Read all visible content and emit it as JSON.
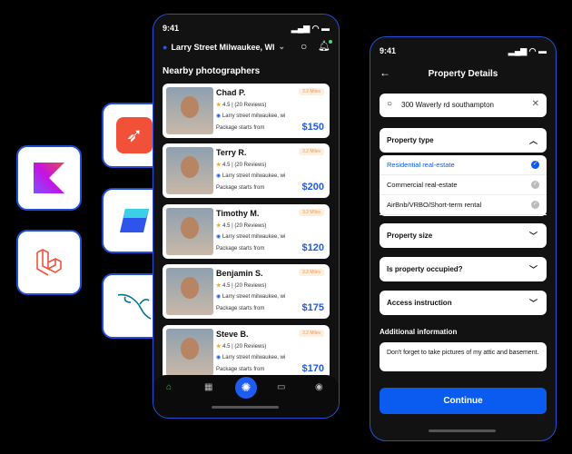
{
  "tech_icons": [
    "swift-icon",
    "kotlin-icon",
    "appwrite-icon",
    "laravel-icon",
    "mysql-icon"
  ],
  "left_phone": {
    "time": "9:41",
    "location": "Larry Street Milwaukee, WI",
    "section_title": "Nearby photographers",
    "photographers": [
      {
        "name": "Chad P.",
        "distance": "3.2 Miles",
        "rating": "4.5",
        "reviews": "(20 Reviews)",
        "address": "Larry street milwaukee, wi",
        "package_label": "Package starts from",
        "price": "$150"
      },
      {
        "name": "Terry R.",
        "distance": "3.2 Miles",
        "rating": "4.5",
        "reviews": "(20 Reviews)",
        "address": "Larry street milwaukee, wi",
        "package_label": "Package starts from",
        "price": "$200"
      },
      {
        "name": "Timothy M.",
        "distance": "3.2 Miles",
        "rating": "4.5",
        "reviews": "(20 Reviews)",
        "address": "Larry street milwaukee, wi",
        "package_label": "Package starts from",
        "price": "$120"
      },
      {
        "name": "Benjamin S.",
        "distance": "3.2 Miles",
        "rating": "4.5",
        "reviews": "(20 Reviews)",
        "address": "Larry street milwaukee, wi",
        "package_label": "Package starts from",
        "price": "$175"
      },
      {
        "name": "Steve B.",
        "distance": "3.2 Miles",
        "rating": "4.5",
        "reviews": "(20 Reviews)",
        "address": "Larry street milwaukee, wi",
        "package_label": "Package starts from",
        "price": "$170"
      }
    ]
  },
  "right_phone": {
    "time": "9:41",
    "title": "Property Details",
    "search_value": "300 Waverly rd southampton",
    "property_type_label": "Property type",
    "options": [
      {
        "label": "Residential real-estate",
        "selected": true
      },
      {
        "label": "Commercial real-estate",
        "selected": false
      },
      {
        "label": "AirBnb/VRBO/Short-term rental",
        "selected": false
      }
    ],
    "property_size_label": "Property size",
    "occupied_label": "Is property occupied?",
    "access_label": "Access instruction",
    "additional_label": "Additional information",
    "additional_value": "Don't forget to take pictures of my attic and basement.",
    "continue_label": "Continue"
  },
  "colors": {
    "accent": "#0a5cf0",
    "background": "#000000",
    "phone_border": "#2350d8"
  }
}
